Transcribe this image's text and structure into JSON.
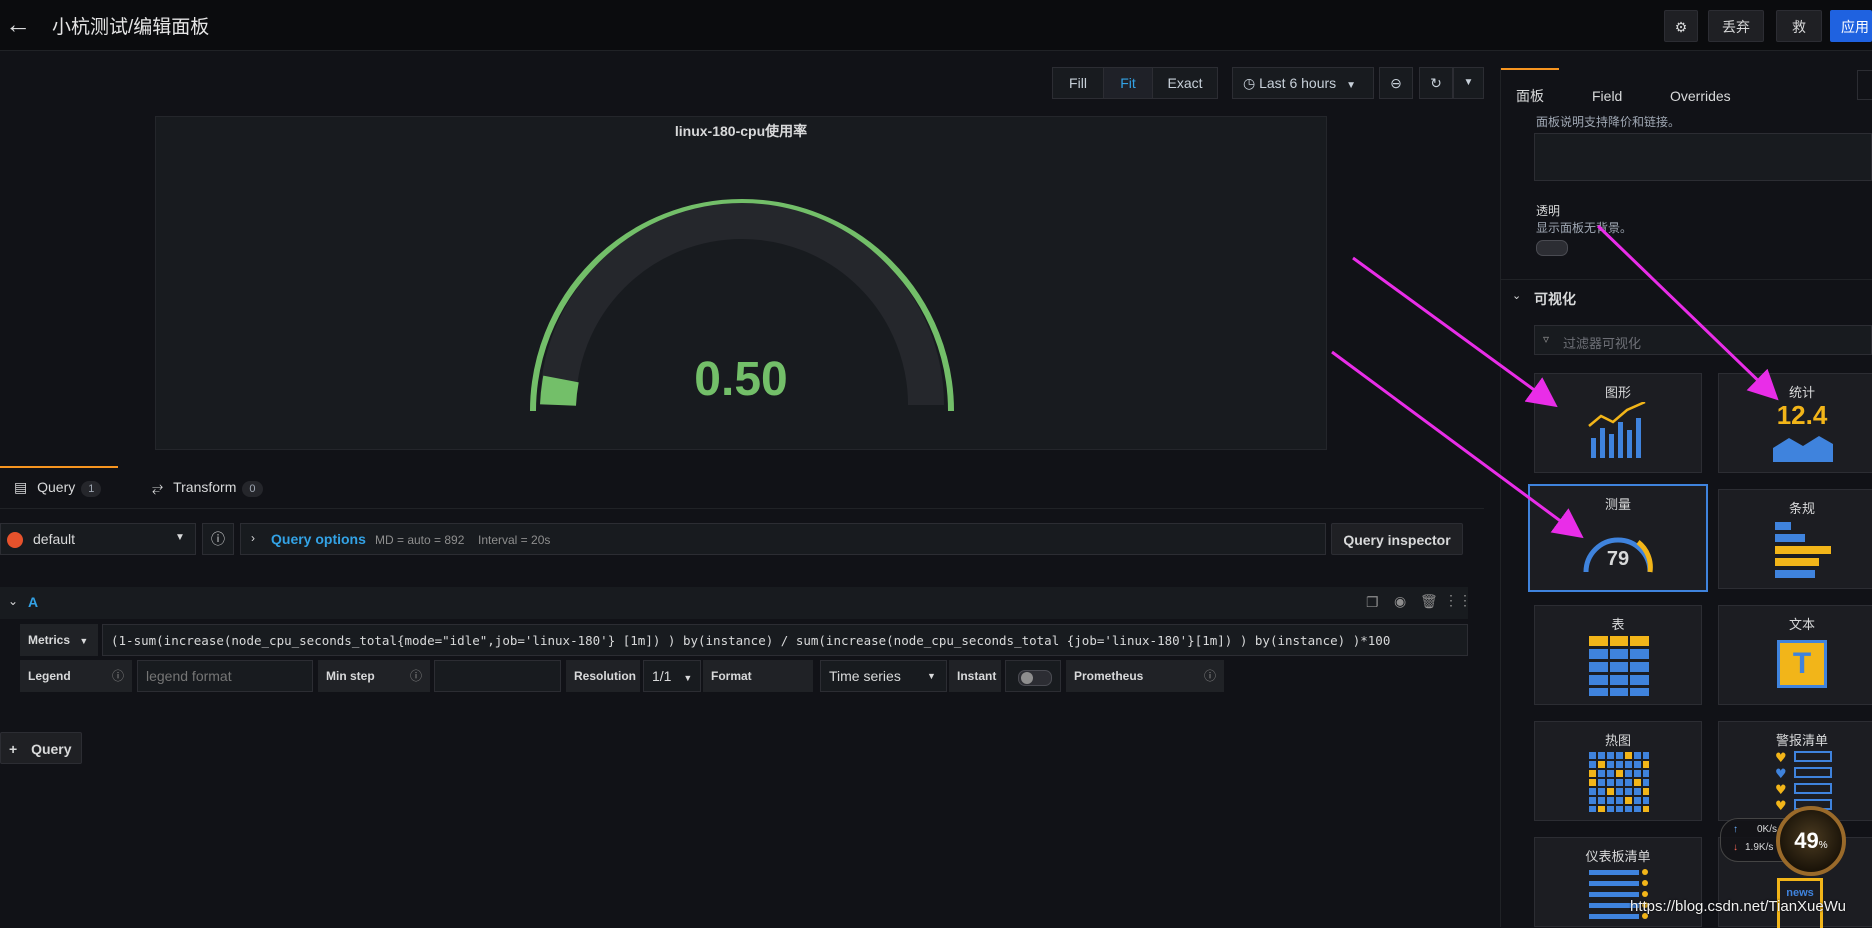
{
  "header": {
    "title": "小杭测试/编辑面板",
    "discard_label": "丢弃",
    "save_label": "救",
    "apply_label": "应用"
  },
  "panel_toolbar": {
    "fill_label": "Fill",
    "fit_label": "Fit",
    "exact_label": "Exact",
    "time_range": "Last 6 hours"
  },
  "panel": {
    "title": "linux-180-cpu使用率",
    "gauge_value": "0.50",
    "gauge_fraction": 0.005,
    "gauge_color": "#73bf69"
  },
  "query_tabs": [
    {
      "label": "Query",
      "count": "1"
    },
    {
      "label": "Transform",
      "count": "0"
    }
  ],
  "datasource": {
    "name": "default",
    "options_label": "Query options",
    "md_text": "MD = auto = 892",
    "interval_text": "Interval = 20s",
    "inspector_label": "Query inspector"
  },
  "query_a": {
    "ref": "A",
    "metrics_label": "Metrics",
    "expression": "(1-sum(increase(node_cpu_seconds_total{mode=\"idle\",job='linux-180'} [1m]) ) by(instance) / sum(increase(node_cpu_seconds_total {job='linux-180'}[1m]) ) by(instance) )*100",
    "legend_label": "Legend",
    "legend_placeholder": "legend format",
    "min_step_label": "Min step",
    "resolution_label": "Resolution",
    "resolution_value": "1/1",
    "format_label": "Format",
    "format_value": "Time series",
    "instant_label": "Instant",
    "prometheus_label": "Prometheus"
  },
  "add_query_label": "Query",
  "sidebar": {
    "tabs": [
      "面板",
      "Field",
      "Overrides"
    ],
    "desc_hint": "面板说明支持降价和链接。",
    "transparent_label": "透明",
    "transparent_hint": "显示面板无背景。",
    "viz_section": "可视化",
    "viz_filter_placeholder": "过滤器可视化",
    "viz_items": [
      "图形",
      "统计",
      "测量",
      "条规",
      "表",
      "文本",
      "热图",
      "警报清单",
      "仪表板清单",
      ""
    ],
    "stat_sample": "12.4",
    "gauge_sample": "79"
  },
  "overlay": {
    "net_up": "0K/s",
    "net_down": "1.9K/s",
    "cpu_percent": "49",
    "percent_sign": "%",
    "news": "news",
    "watermark": "https://blog.csdn.net/TianXueWu"
  },
  "colors": {
    "accent": "#33a2e5",
    "annotation_arrow": "#e92de8",
    "apply": "#1f62e0"
  }
}
